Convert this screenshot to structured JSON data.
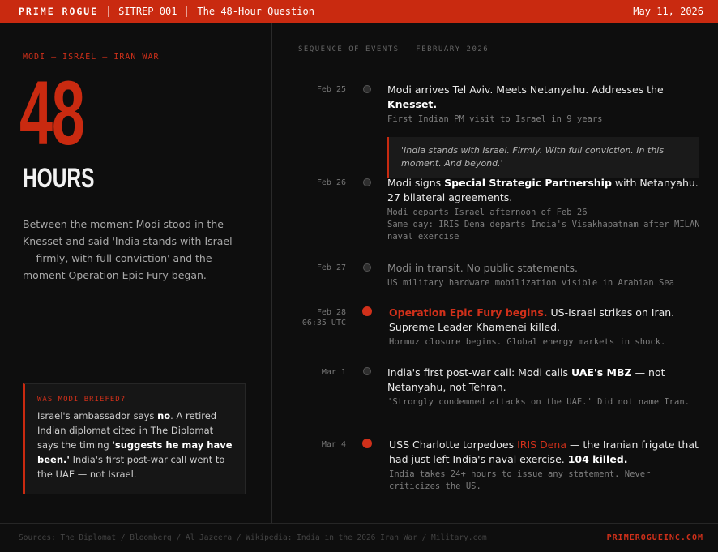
{
  "topbar": {
    "brand": "PRIME ROGUE",
    "code": "SITREP 001",
    "headline": "The 48-Hour Question",
    "date": "May 11, 2026"
  },
  "left": {
    "kicker": "MODI — ISRAEL — IRAN WAR",
    "big_number": "48",
    "big_unit": "HOURS",
    "intro": "Between the moment Modi stood in the Knesset and said 'India stands with Israel — firmly, with full conviction' and the moment Operation Epic Fury began.",
    "callout": {
      "heading": "WAS MODI BRIEFED?",
      "t1": "Israel's ambassador says ",
      "b1": "no",
      "t2": ". A retired Indian diplomat cited in The Diplomat says the timing ",
      "b2": "'suggests he may have been.'",
      "t3": " India's first post-war call went to the UAE — not Israel."
    }
  },
  "timeline": {
    "heading": "SEQUENCE OF EVENTS — FEBRUARY 2026",
    "events": [
      {
        "date": "Feb 25",
        "time": "",
        "t1": "Modi arrives Tel Aviv. Meets Netanyahu. Addresses the ",
        "b1": "Knesset.",
        "sub": "First Indian PM visit to Israel in 9 years",
        "quote": "'India stands with Israel. Firmly. With full conviction. In this moment. And beyond.'"
      },
      {
        "date": "Feb 26",
        "time": "",
        "t1": "Modi signs ",
        "b1": "Special Strategic Partnership",
        "t2": " with Netanyahu. 27 bilateral agreements.",
        "sub1": "Modi departs Israel afternoon of Feb 26",
        "sub2": "Same day: IRIS Dena departs India's Visakhapatnam after MILAN naval exercise"
      },
      {
        "date": "Feb 27",
        "time": "",
        "t1": "Modi in transit. No public statements.",
        "sub": "US military hardware mobilization visible in Arabian Sea"
      },
      {
        "date": "Feb 28",
        "time": "06:35 UTC",
        "hl": "Operation Epic Fury begins.",
        "t1": " US-Israel strikes on Iran. Supreme Leader Khamenei killed.",
        "sub": "Hormuz closure begins. Global energy markets in shock."
      },
      {
        "date": "Mar 1",
        "time": "",
        "t1": "India's first post-war call: Modi calls ",
        "b1": "UAE's MBZ",
        "t2": " — not Netanyahu, not Tehran.",
        "sub": "'Strongly condemned attacks on the UAE.' Did not name Iran."
      },
      {
        "date": "Mar 4",
        "time": "",
        "t1": "USS Charlotte torpedoes ",
        "hl": "IRIS Dena",
        "t2": " — the Iranian frigate that had just left India's naval exercise. ",
        "b1": "104 killed.",
        "sub": "India takes 24+ hours to issue any statement. Never criticizes the US."
      }
    ]
  },
  "footer": {
    "sources": "Sources: The Diplomat / Bloomberg / Al Jazeera / Wikipedia: India in the 2026 Iran War / Military.com",
    "site": "PRIMEROGUEINC.COM"
  },
  "colors": {
    "accent": "#c92a10",
    "background": "#0e0e0e"
  }
}
